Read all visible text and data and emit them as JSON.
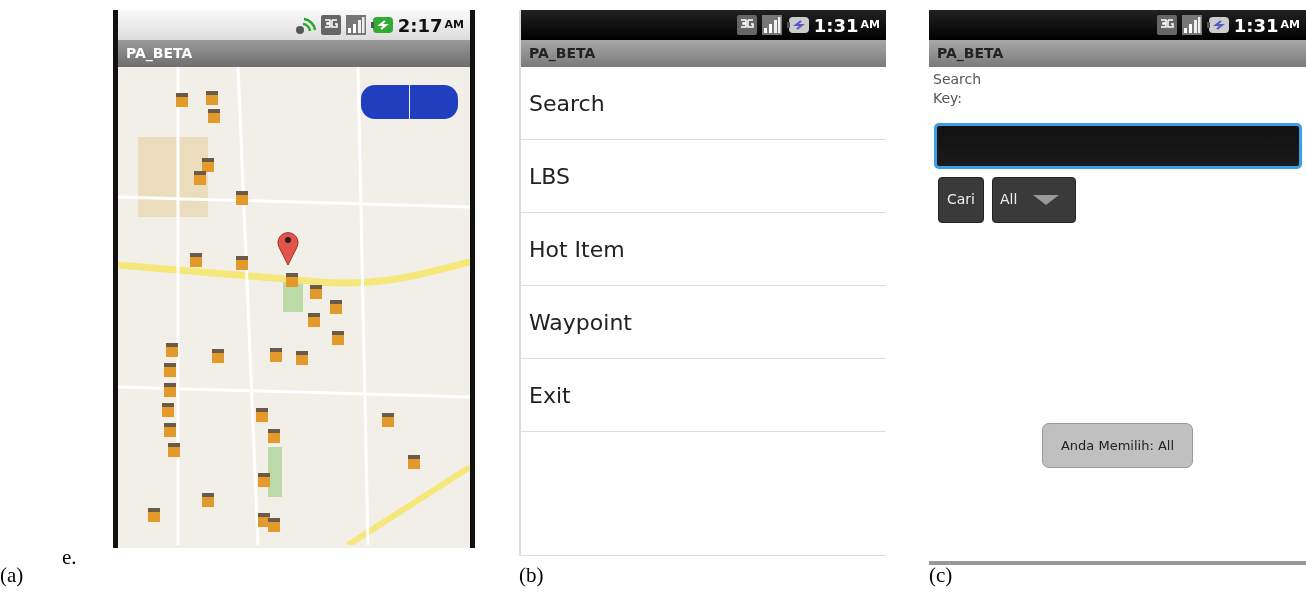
{
  "figure_label": "e.",
  "panels": [
    {
      "kind": "map",
      "caption": "(a)",
      "status_bar": {
        "kind": "light",
        "gps": true,
        "time": "2:17",
        "meridiem": "AM"
      },
      "title": "PA_BETA"
    },
    {
      "kind": "menu",
      "caption": "(b)",
      "status_bar": {
        "kind": "dark",
        "gps": false,
        "time": "1:31",
        "meridiem": "AM"
      },
      "title": "PA_BETA",
      "items": [
        "Search",
        "LBS",
        "Hot Item",
        "Waypoint",
        "Exit"
      ]
    },
    {
      "kind": "search",
      "caption": "(c)",
      "status_bar": {
        "kind": "dark",
        "gps": false,
        "time": "1:31",
        "meridiem": "AM"
      },
      "title": "PA_BETA",
      "label": "Search Key:",
      "button": "Cari",
      "spinner": {
        "value": "All"
      },
      "toast": "Anda Memilih: All"
    }
  ]
}
